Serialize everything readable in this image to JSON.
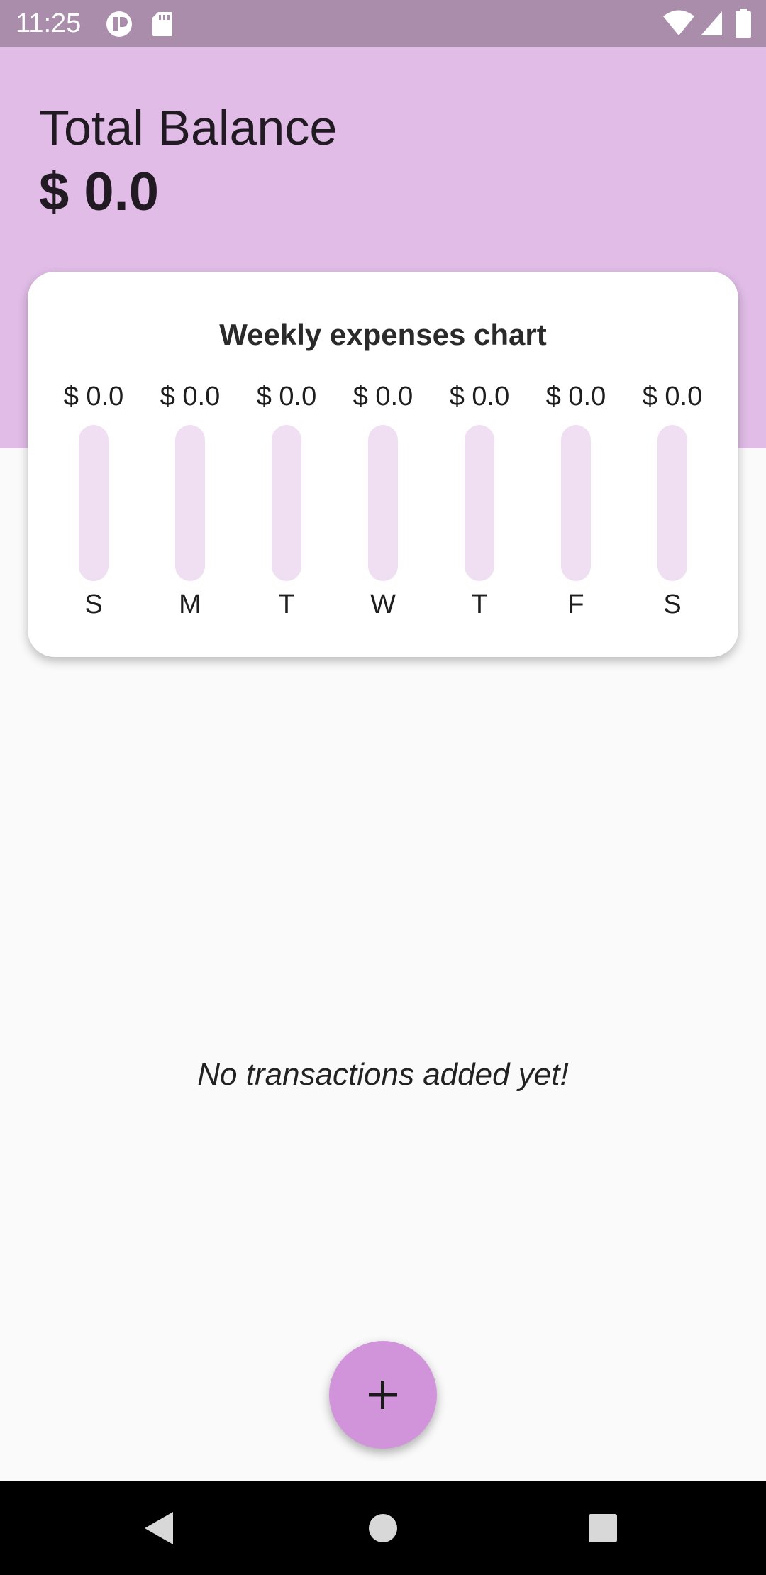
{
  "status_bar": {
    "time": "11:25",
    "left_icons": [
      "app-notification-icon",
      "sd-card-icon"
    ],
    "right_icons": [
      "wifi-icon",
      "signal-icon",
      "battery-icon"
    ]
  },
  "header": {
    "balance_label": "Total Balance",
    "balance_value": "$ 0.0",
    "background_color": "#e0bce6"
  },
  "chart_card": {
    "title": "Weekly expenses chart",
    "chart_data": {
      "type": "bar",
      "title": "Weekly expenses chart",
      "categories": [
        "S",
        "M",
        "T",
        "W",
        "T",
        "F",
        "S"
      ],
      "value_labels": [
        "$ 0.0",
        "$ 0.0",
        "$ 0.0",
        "$ 0.0",
        "$ 0.0",
        "$ 0.0",
        "$ 0.0"
      ],
      "values": [
        0,
        0,
        0,
        0,
        0,
        0,
        0
      ],
      "bar_track_color": "#f0def2"
    }
  },
  "transactions": {
    "empty_message": "No transactions added yet!"
  },
  "fab": {
    "icon": "plus-icon",
    "color": "#d194db"
  },
  "navigation_bar": {
    "buttons": [
      "back-icon",
      "home-icon",
      "recents-icon"
    ]
  }
}
